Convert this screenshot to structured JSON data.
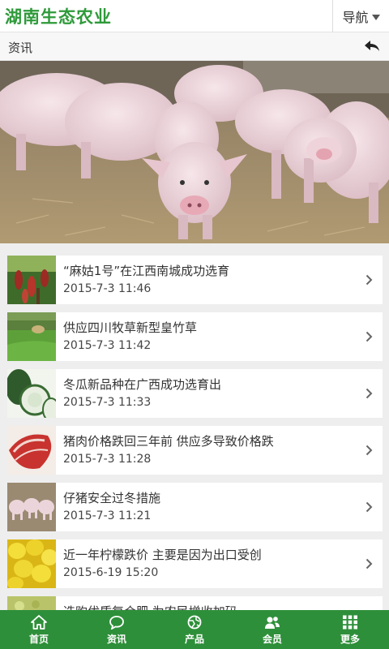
{
  "header": {
    "logo": "湖南生态农业",
    "nav_label": "导航",
    "nav_icon": "caret-down-icon"
  },
  "subbar": {
    "title": "资讯",
    "back_icon": "back-arrow-icon"
  },
  "banner": {
    "description_icon": "banner-image",
    "slide_count": 2,
    "active_slide": 1
  },
  "news": [
    {
      "title": "“麻姑1号”在江西南城成功选育",
      "date": "2015-7-3 11:46",
      "thumb": "fruit-tree"
    },
    {
      "title": "供应四川牧草新型皇竹草",
      "date": "2015-7-3 11:42",
      "thumb": "grass-field"
    },
    {
      "title": "冬瓜新品种在广西成功选育出",
      "date": "2015-7-3 11:33",
      "thumb": "wax-gourd"
    },
    {
      "title": "猪肉价格跌回三年前 供应多导致价格跌",
      "date": "2015-7-3 11:28",
      "thumb": "pork"
    },
    {
      "title": "仔猪安全过冬措施",
      "date": "2015-7-3 11:21",
      "thumb": "piglets"
    },
    {
      "title": "近一年柠檬跌价 主要是因为出口受创",
      "date": "2015-6-19 15:20",
      "thumb": "lemons"
    },
    {
      "title": "选购优质复合肥 为农民增收加码",
      "date": "",
      "thumb": "fertilizer"
    }
  ],
  "footer": {
    "tabs": [
      {
        "label": "首页",
        "icon": "home-icon"
      },
      {
        "label": "资讯",
        "icon": "chat-icon"
      },
      {
        "label": "产品",
        "icon": "globe-icon"
      },
      {
        "label": "会员",
        "icon": "users-icon"
      },
      {
        "label": "更多",
        "icon": "grid-icon"
      }
    ]
  },
  "colors": {
    "brand": "#2e9a3a",
    "footer_bg": "#2e8f3a",
    "page_bg": "#eeeeee"
  }
}
